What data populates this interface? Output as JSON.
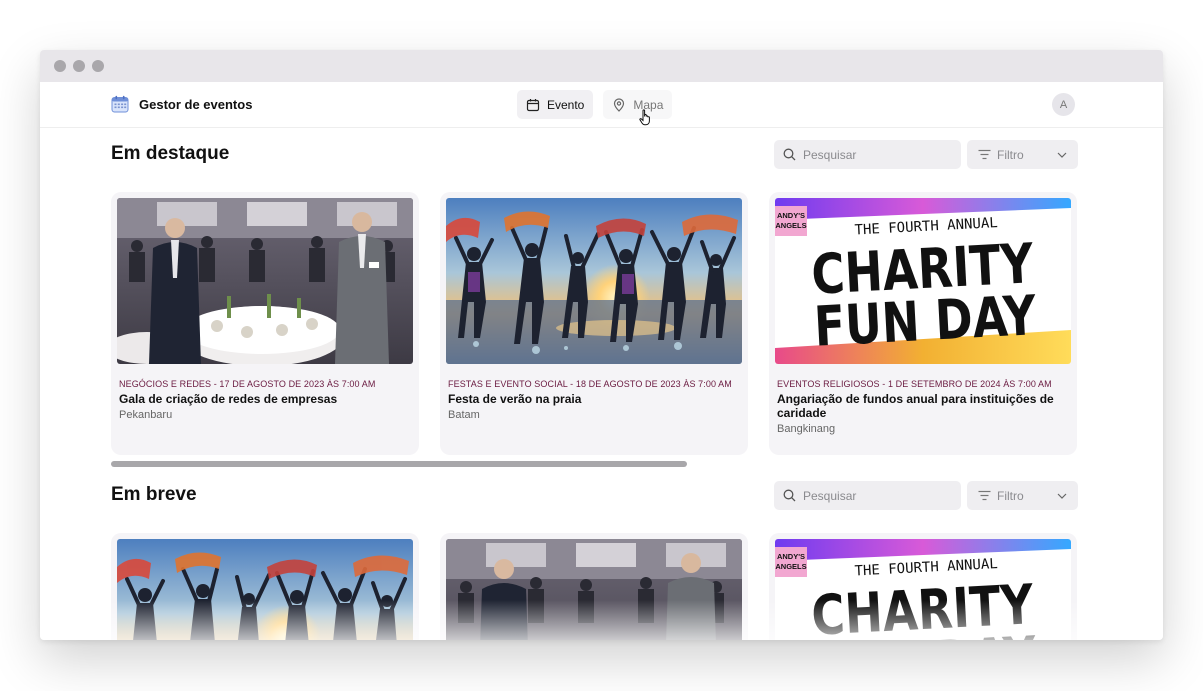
{
  "app": {
    "title": "Gestor de eventos"
  },
  "nav": {
    "events_label": "Evento",
    "map_label": "Mapa"
  },
  "user": {
    "avatar_initial": "A"
  },
  "featured": {
    "title": "Em destaque",
    "search_placeholder": "Pesquisar",
    "filter_label": "Filtro",
    "cards": [
      {
        "meta": "Negócios e redes - 17 de agosto de 2023 às 7:00 AM",
        "title": "Gala de criação de redes de empresas",
        "location": "Pekanbaru",
        "image": "business-gala-photo"
      },
      {
        "meta": "Festas e evento social - 18 de agosto de 2023 às 7:00 AM",
        "title": "Festa de verão na praia",
        "location": "Batam",
        "image": "beach-party-photo"
      },
      {
        "meta": "Eventos religiosos - 1 de setembro de 2024 às 7:00 AM",
        "title": "Angariação de fundos anual para instituições de caridade",
        "location": "Bangkinang",
        "image": "charity-poster"
      }
    ]
  },
  "poster": {
    "corner_line1": "ANDY'S",
    "corner_line2": "ANGELS",
    "annual": "THE FOURTH ANNUAL",
    "line1": "CHARITY",
    "line2": "FUN DAY"
  },
  "upcoming": {
    "title": "Em breve",
    "search_placeholder": "Pesquisar",
    "filter_label": "Filtro",
    "cards": [
      {
        "image": "beach-party-photo"
      },
      {
        "image": "business-gala-photo"
      },
      {
        "image": "charity-poster"
      }
    ]
  },
  "colors": {
    "accent_meta": "#6a1a40",
    "window_bar": "#e8e6ea"
  }
}
